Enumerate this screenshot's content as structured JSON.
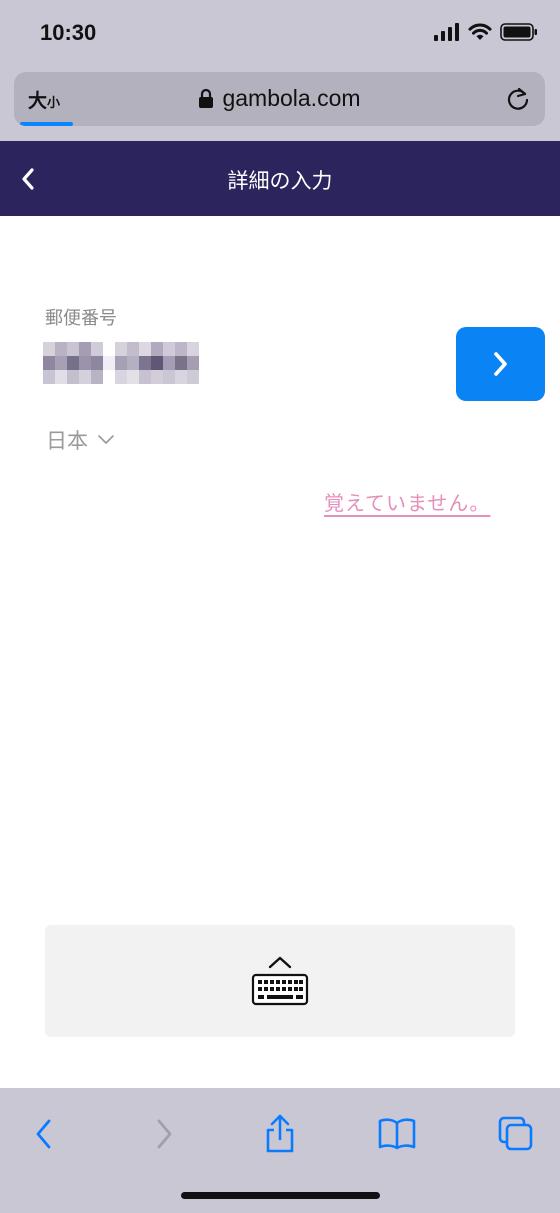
{
  "status_bar": {
    "time": "10:30",
    "icons": [
      "signal-icon",
      "wifi-icon",
      "battery-icon"
    ]
  },
  "browser": {
    "text_size_label": "大",
    "text_size_small": "小",
    "url": "gambola.com",
    "load_progress": 0.1
  },
  "header": {
    "title": "詳細の入力",
    "back_icon": "chevron-left-icon"
  },
  "form": {
    "postal_code_label": "郵便番号",
    "country_value": "日本",
    "forgot_link": "覚えていません。",
    "next_icon": "chevron-right-icon"
  },
  "keyboard_toggle": {
    "icon": "keyboard-show-icon"
  },
  "toolbar": {
    "icons": [
      "back-icon",
      "forward-icon",
      "share-icon",
      "bookmarks-icon",
      "tabs-icon"
    ]
  },
  "colors": {
    "header_bg": "#2b245d",
    "accent_blue": "#0a84f5",
    "link_pink": "#e58fba",
    "browser_chrome": "#c9c7d3"
  }
}
